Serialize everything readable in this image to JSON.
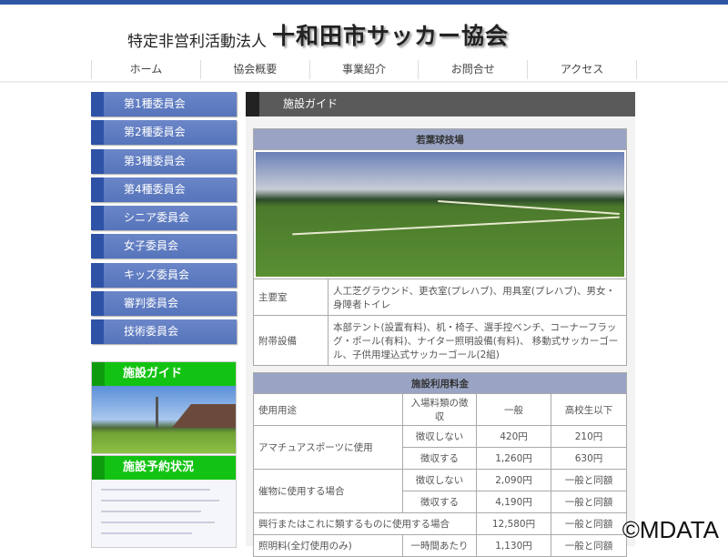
{
  "header": {
    "subtitle": "特定非営利活動法人",
    "title": "十和田市サッカー協会"
  },
  "nav": [
    "ホーム",
    "協会概要",
    "事業紹介",
    "お問合せ",
    "アクセス"
  ],
  "sidebar": {
    "items": [
      "第1種委員会",
      "第2種委員会",
      "第3種委員会",
      "第4種委員会",
      "シニア委員会",
      "女子委員会",
      "キッズ委員会",
      "審判委員会",
      "技術委員会"
    ],
    "panels": [
      "施設ガイド",
      "施設予約状況"
    ]
  },
  "main": {
    "heading": "施設ガイド",
    "facility": {
      "name": "若葉球技場",
      "rows": [
        {
          "label": "主要室",
          "value": "人工芝グラウンド、更衣室(プレハブ)、用具室(プレハブ)、男女・身障者トイレ"
        },
        {
          "label": "附帯設備",
          "value": "本部テント(設置有料)、机・椅子、選手控ベンチ、コーナーフラッグ・ポール(有料)、ナイター照明設備(有料)、 移動式サッカーゴール、子供用埋込式サッカーゴール(2組)"
        }
      ]
    },
    "fees": {
      "title": "施設利用料金",
      "headers": [
        "使用用途",
        "入場料類の徴収",
        "一般",
        "高校生以下"
      ],
      "amateur": {
        "label": "アマチュアスポーツに使用",
        "rows": [
          [
            "徴収しない",
            "420円",
            "210円"
          ],
          [
            "徴収する",
            "1,260円",
            "630円"
          ]
        ]
      },
      "event": {
        "label": "催物に使用する場合",
        "rows": [
          [
            "徴収しない",
            "2,090円",
            "一般と同額"
          ],
          [
            "徴収する",
            "4,190円",
            "一般と同額"
          ]
        ]
      },
      "kogyo": [
        "興行またはこれに類するものに使用する場合",
        "12,580円",
        "一般と同額"
      ],
      "light": [
        "照明料(全灯使用のみ)",
        "一時間あたり",
        "1,130円",
        "一般と同額"
      ]
    }
  },
  "watermark": "©MDATA"
}
